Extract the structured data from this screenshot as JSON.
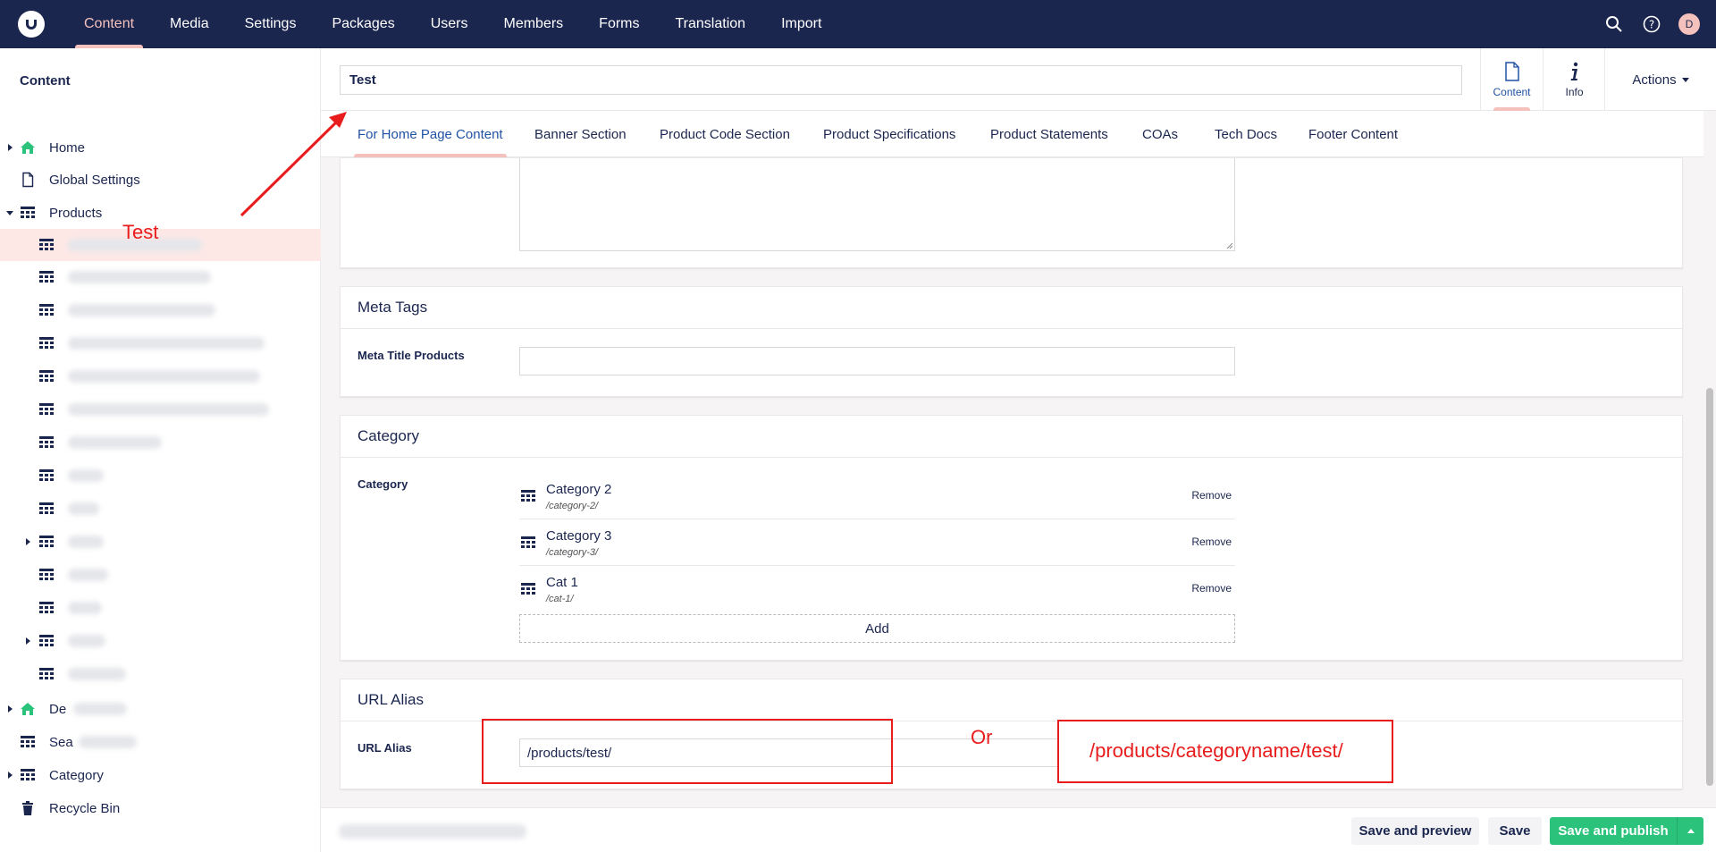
{
  "topnav": {
    "items": [
      "Content",
      "Media",
      "Settings",
      "Packages",
      "Users",
      "Members",
      "Forms",
      "Translation",
      "Import"
    ],
    "active": "Content",
    "avatar_initial": "D"
  },
  "sidebar": {
    "title": "Content",
    "items": {
      "home": "Home",
      "global_settings": "Global Settings",
      "products": "Products",
      "de_partial": "De",
      "sea_partial": "Sea",
      "category": "Category",
      "recycle_bin": "Recycle Bin"
    }
  },
  "header": {
    "name_value": "Test",
    "apps": {
      "content": "Content",
      "info": "Info"
    },
    "actions_label": "Actions"
  },
  "tabs": [
    "For Home Page Content",
    "Banner Section",
    "Product Code Section",
    "Product Specifications",
    "Product Statements",
    "COAs",
    "Tech Docs",
    "Footer Content"
  ],
  "meta": {
    "title": "Meta Tags",
    "label": "Meta Title Products"
  },
  "category": {
    "title": "Category",
    "label": "Category",
    "items": [
      {
        "name": "Category 2",
        "url": "/category-2/",
        "remove": "Remove"
      },
      {
        "name": "Category 3",
        "url": "/category-3/",
        "remove": "Remove"
      },
      {
        "name": "Cat 1",
        "url": "/cat-1/",
        "remove": "Remove"
      }
    ],
    "add_label": "Add"
  },
  "url_alias": {
    "title": "URL Alias",
    "label": "URL Alias",
    "value": "/products/test/"
  },
  "annotations": {
    "test_label": "Test",
    "or_label": "Or",
    "alt_url": "/products/categoryname/test/"
  },
  "footer": {
    "preview": "Save and preview",
    "save": "Save",
    "publish": "Save and publish"
  },
  "colors": {
    "brand": "#1b264f",
    "accent": "#f5c1bc",
    "publish": "#2bc37c",
    "annotation": "#e81c1c"
  }
}
